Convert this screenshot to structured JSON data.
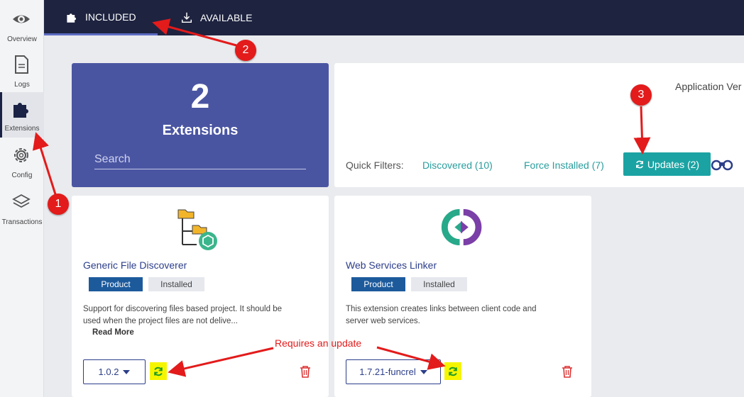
{
  "sidebar": {
    "items": [
      {
        "label": "Overview",
        "icon": "eye-icon"
      },
      {
        "label": "Logs",
        "icon": "document-icon"
      },
      {
        "label": "Extensions",
        "icon": "puzzle-icon",
        "active": true
      },
      {
        "label": "Config",
        "icon": "gear-icon"
      },
      {
        "label": "Transactions",
        "icon": "layers-icon"
      }
    ]
  },
  "topnav": {
    "tabs": [
      {
        "label": "INCLUDED",
        "icon": "puzzle-icon",
        "active": true
      },
      {
        "label": "AVAILABLE",
        "icon": "download-icon"
      }
    ]
  },
  "count_card": {
    "count": "2",
    "label": "Extensions",
    "search_placeholder": "Search"
  },
  "filters": {
    "app_version_label": "Application Ver",
    "quick_filters_label": "Quick Filters:",
    "discovered": "Discovered (10)",
    "force_installed": "Force Installed (7)",
    "updates": "Updates (2)"
  },
  "extensions": [
    {
      "title": "Generic File Discoverer",
      "badge_product": "Product",
      "badge_installed": "Installed",
      "desc_line1": "Support for discovering files based project. It should be",
      "desc_line2": "used when the project files are not delive...",
      "read_more": "Read More",
      "version": "1.0.2"
    },
    {
      "title": "Web Services Linker",
      "badge_product": "Product",
      "badge_installed": "Installed",
      "desc_line1": "This extension creates links between client code and",
      "desc_line2": "server web services.",
      "version": "1.7.21-funcrel"
    }
  ],
  "annotations": {
    "marker1": "1",
    "marker2": "2",
    "marker3": "3",
    "note": "Requires an update"
  },
  "colors": {
    "nav_bg": "#1e2340",
    "card_blue": "#4a55a2",
    "teal": "#1ba3a3",
    "annotation_red": "#e31b1b"
  }
}
